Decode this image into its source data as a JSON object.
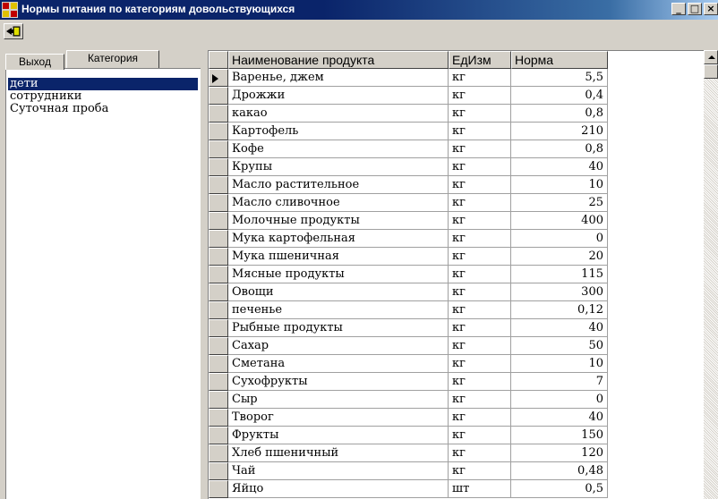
{
  "window": {
    "title": "Нормы питания по категориям довольствующихся",
    "buttons": {
      "minimize": "_",
      "maximize": "□",
      "close": "×"
    }
  },
  "toolbar": {
    "exit_button_icon": "exit-door-icon"
  },
  "tabs": {
    "exit": "Выход",
    "category": "Категория"
  },
  "categories": [
    {
      "label": "дети",
      "selected": true
    },
    {
      "label": "сотрудники",
      "selected": false
    },
    {
      "label": "Суточная проба",
      "selected": false
    }
  ],
  "grid": {
    "columns": [
      "Наименование продукта",
      "ЕдИзм",
      "Норма"
    ],
    "rows": [
      [
        "Варенье, джем",
        "кг",
        "5,5"
      ],
      [
        "Дрожжи",
        "кг",
        "0,4"
      ],
      [
        "какао",
        "кг",
        "0,8"
      ],
      [
        "Картофель",
        "кг",
        "210"
      ],
      [
        "Кофе",
        "кг",
        "0,8"
      ],
      [
        "Крупы",
        "кг",
        "40"
      ],
      [
        "Масло растительное",
        "кг",
        "10"
      ],
      [
        "Масло сливочное",
        "кг",
        "25"
      ],
      [
        "Молочные продукты",
        "кг",
        "400"
      ],
      [
        "Мука картофельная",
        "кг",
        "0"
      ],
      [
        "Мука пшеничная",
        "кг",
        "20"
      ],
      [
        "Мясные продукты",
        "кг",
        "115"
      ],
      [
        "Овощи",
        "кг",
        "300"
      ],
      [
        "печенье",
        "кг",
        "0,12"
      ],
      [
        "Рыбные продукты",
        "кг",
        "40"
      ],
      [
        "Сахар",
        "кг",
        "50"
      ],
      [
        "Сметана",
        "кг",
        "10"
      ],
      [
        "Сухофрукты",
        "кг",
        "7"
      ],
      [
        "Сыр",
        "кг",
        "0"
      ],
      [
        "Творог",
        "кг",
        "40"
      ],
      [
        "Фрукты",
        "кг",
        "150"
      ],
      [
        "Хлеб пшеничный",
        "кг",
        "120"
      ],
      [
        "Чай",
        "кг",
        "0,48"
      ],
      [
        "Яйцо",
        "шт",
        "0,5"
      ]
    ],
    "current_row": 0
  },
  "colors": {
    "selection": "#0a246a",
    "face": "#d4d0c8",
    "title_start": "#0a246a"
  }
}
